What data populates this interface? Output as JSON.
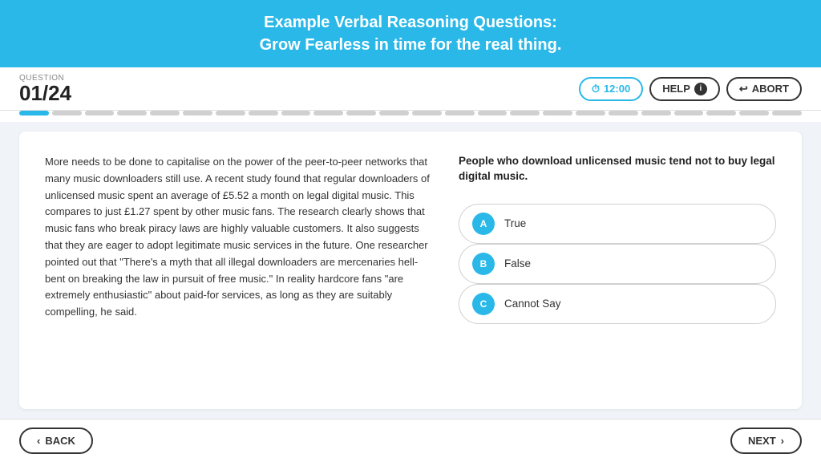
{
  "header": {
    "line1": "Example Verbal Reasoning Questions:",
    "line2": "Grow Fearless in time for the real thing."
  },
  "toolbar": {
    "question_label": "QUESTION",
    "question_number": "01/24",
    "timer": "12:00",
    "help_label": "HELP",
    "abort_label": "ABORT"
  },
  "progress": {
    "total": 24,
    "current": 1
  },
  "passage": {
    "text": "More needs to be done to capitalise on the power of the peer-to-peer networks that many music downloaders still use. A recent study found that regular downloaders of unlicensed music spent an average of £5.52 a month on legal digital music. This compares to just £1.27 spent by other music fans. The research clearly shows that music fans who break piracy laws are highly valuable customers. It also suggests that they are eager to adopt legitimate music services in the future. One researcher pointed out that \"There's a myth that all illegal downloaders are mercenaries hell-bent on breaking the law in pursuit of free music.\" In reality hardcore fans \"are extremely enthusiastic\" about paid-for services, as long as they are suitably compelling, he said."
  },
  "question": {
    "text": "People who download unlicensed music tend not to buy legal digital music.",
    "options": [
      {
        "id": "A",
        "label": "True"
      },
      {
        "id": "B",
        "label": "False"
      },
      {
        "id": "C",
        "label": "Cannot Say"
      }
    ]
  },
  "footer": {
    "back_label": "BACK",
    "next_label": "NEXT"
  }
}
